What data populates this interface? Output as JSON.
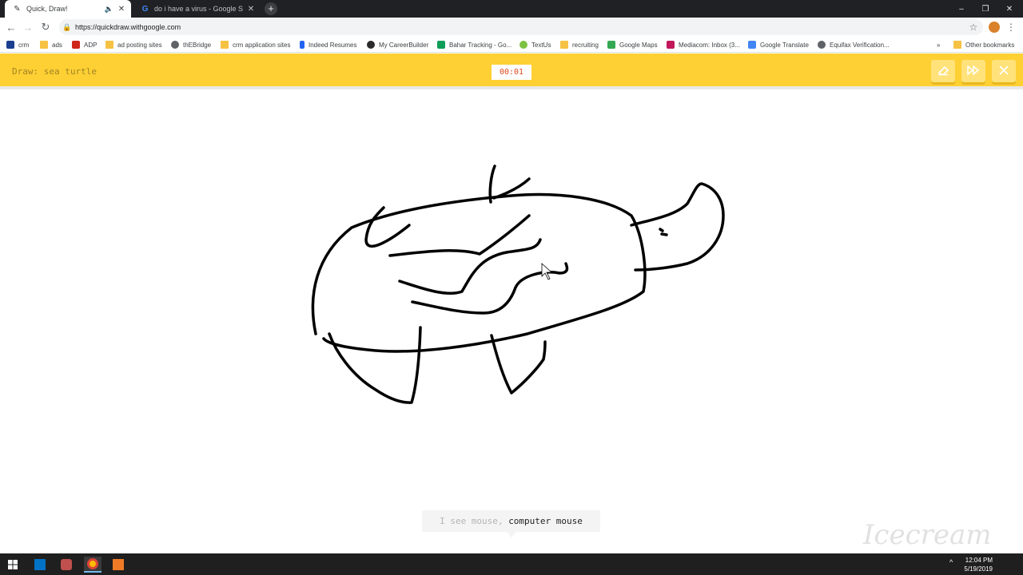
{
  "browser": {
    "tabs": [
      {
        "title": "Quick, Draw!",
        "active": true
      },
      {
        "title": "do i have a virus - Google Search",
        "active": false
      }
    ],
    "url": "https://quickdraw.withgoogle.com",
    "window_controls": [
      "–",
      "❐",
      "✕"
    ]
  },
  "bookmarks": [
    {
      "label": "crm",
      "icon": "crm-icon"
    },
    {
      "label": "ads",
      "icon": "folder-icon"
    },
    {
      "label": "ADP",
      "icon": "adp-icon"
    },
    {
      "label": "ad posting sites",
      "icon": "folder-icon"
    },
    {
      "label": "thEBridge",
      "icon": "globe-icon"
    },
    {
      "label": "crm application sites",
      "icon": "folder-icon"
    },
    {
      "label": "Indeed Resumes",
      "icon": "indeed-icon"
    },
    {
      "label": "My CareerBuilder",
      "icon": "careerbuilder-icon"
    },
    {
      "label": "Bahar Tracking - Go...",
      "icon": "sheets-icon"
    },
    {
      "label": "TextUs",
      "icon": "textus-icon"
    },
    {
      "label": "recruiting",
      "icon": "folder-icon"
    },
    {
      "label": "Google Maps",
      "icon": "maps-icon"
    },
    {
      "label": "Mediacom: Inbox (3...",
      "icon": "mediacom-icon"
    },
    {
      "label": "Google Translate",
      "icon": "translate-icon"
    },
    {
      "label": "Equifax Verification...",
      "icon": "globe-icon"
    },
    {
      "label": "»",
      "icon": ""
    },
    {
      "label": "Other bookmarks",
      "icon": "folder-icon"
    }
  ],
  "quickdraw": {
    "prompt": "Draw: sea turtle",
    "timer": "00:01",
    "guess_prefix": "I see mouse,",
    "guess_current": "computer mouse",
    "colors": {
      "header": "#ffd033",
      "timer_text": "#e2471b"
    }
  },
  "taskbar": {
    "time": "12:04 PM",
    "date": "5/19/2019"
  },
  "watermark": "Icecream APPS"
}
